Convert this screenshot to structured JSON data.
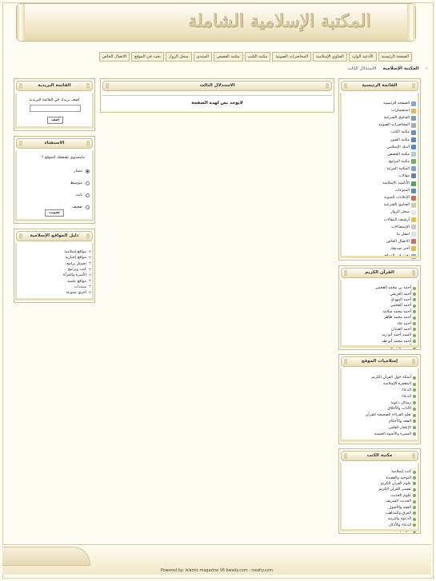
{
  "header": {
    "title": "المكتبة الإسلامية الشاملة"
  },
  "topnav": [
    "الصفحة الرئيسية",
    "الأدعية الوارد",
    "الفتاوي الإسلامية",
    "المحاضرات الصوتية",
    "مكتبة الكتب",
    "مكتبة القصص",
    "المنتدى",
    "سجل الزوار",
    "بحث في الموقع",
    "الاتصال الخاص"
  ],
  "breadcrumb": {
    "root": "المكتبة الإسلامية",
    "current": "الاستدلال الثالث"
  },
  "center": {
    "box_title": "الاستدلال الثالث",
    "message": "لايوجد نص لهذه الصفحة"
  },
  "main_menu": {
    "title": "القائمة الرئيسية",
    "items": [
      {
        "label": "الصفحة الرئيسية",
        "color": "#8aa7c8"
      },
      {
        "label": "استفسارات",
        "color": "#e3b948"
      },
      {
        "label": "الفتاوي الشرعية",
        "color": "#7c9ac0"
      },
      {
        "label": "المحاضرات الصوتية",
        "color": "#a8a8a8"
      },
      {
        "label": "مكتبة الكتب",
        "color": "#6b8fc4"
      },
      {
        "label": "مكتبة الصور",
        "color": "#5a86c9"
      },
      {
        "label": "البنك الإسلامي",
        "color": "#4e8bd0"
      },
      {
        "label": "مكتبة القصص",
        "color": "#b7c6e0"
      },
      {
        "label": "مكتبة البرامج",
        "color": "#6fb05a"
      },
      {
        "label": "المكتبة المرئية",
        "color": "#7da2c9"
      },
      {
        "label": "مقالات",
        "color": "#6c7fa4"
      },
      {
        "label": "الأناشيد الإسلامية",
        "color": "#4fa84a"
      },
      {
        "label": "المنوعات",
        "color": "#5c8cc8"
      },
      {
        "label": "الإعلانات المبوبة",
        "color": "#d86a5c"
      },
      {
        "label": "الفتاوى الشرعية",
        "color": "#d1cc9b"
      },
      {
        "label": "سجل الزوار",
        "color": "#e6e6e6"
      },
      {
        "label": "أرشيف المقالات",
        "color": "#e8c040"
      },
      {
        "label": "الإستفتاءات",
        "color": "#c8c8c8"
      },
      {
        "label": "اتصل بنا",
        "color": "#e0e0e0"
      },
      {
        "label": "الاتصال الخاص",
        "color": "#d46a5a"
      },
      {
        "label": "أخبر صديقك",
        "color": "#e3b948"
      },
      {
        "label": "بحث في الموقع",
        "color": "#8aa7c8"
      }
    ]
  },
  "quran": {
    "title": "القرآن الكريم",
    "items": [
      "أحمد بن محمد العجمي",
      "أحمد العريفي",
      "أحمد المهدي",
      "أحمد العجمي",
      "أحمد محمد سلامة",
      "أحمد محمد طاهر",
      "أحمد جاد",
      "أحمد العبدان",
      "السيد أحمد أبو زيد",
      "أحمد محمد أبو طه",
      "أحمد بن علي"
    ]
  },
  "site_sections": {
    "title": "إسلاميات الموقع",
    "items": [
      "أسئلة حول القرآن الكريم",
      "المعجزة الإسلامية",
      "الدعاء",
      "الدعاء",
      "رسائل دعوية",
      "الآداب والأخلاق",
      "تعلم القراءة الصحيحة للقرآن",
      "الفقه والأحكام",
      "الإعجاز العلمي",
      "السيرة والأسوة الحسنة"
    ]
  },
  "books": {
    "title": "مكتبة الكتب",
    "items": [
      "كتب إسلامية",
      "التوحيد والعقيدة",
      "علوم القرآن الكريم",
      "تفسير القرآن الكريم",
      "علوم الحديث",
      "الحديث الشريف",
      "الفقه والأصول",
      "الفرق والمذاهب",
      "الدعوة والتربية",
      "الدعاء والأذكار",
      "التراجم"
    ]
  },
  "subscribe": {
    "title": "القائمة البريدية",
    "label": "أضف بريدك في القائمة البريدية",
    "button": "اضف"
  },
  "poll": {
    "title": "الاستفتاء",
    "question": "مامستوى تصفحك للموقع ؟",
    "options": [
      {
        "label": "ممتاز",
        "selected": true
      },
      {
        "label": "متوسط",
        "selected": false
      },
      {
        "label": "ثابت",
        "selected": false
      },
      {
        "label": "ضعيف",
        "selected": false
      }
    ],
    "button": "تصويت"
  },
  "links": {
    "title": "دليل المواقع الإسلامية",
    "items": [
      "مواقع إسلامية",
      "مواقع إخبارية",
      "تحميل برامج",
      "كتب وبرامج",
      "الأسرة والمرأة",
      "مواقع علمية",
      "منتديات",
      "أخرى متنوعة"
    ]
  },
  "footer": {
    "credit": "Powered by: Islamic magazine V6 bwady.com - nwahy.com"
  }
}
